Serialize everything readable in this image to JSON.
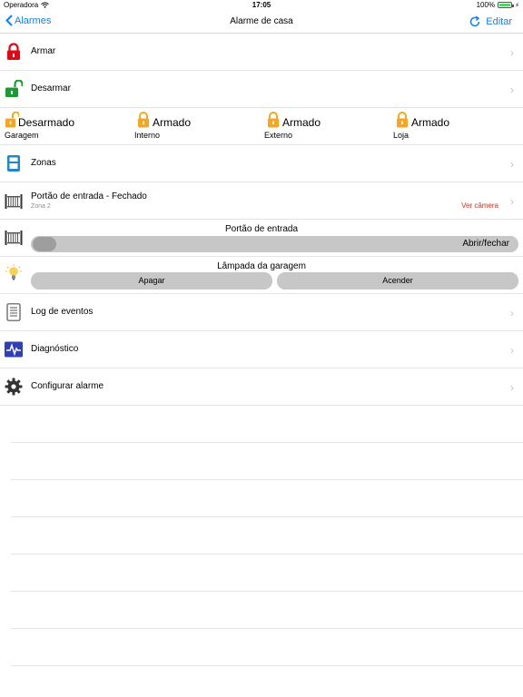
{
  "status_bar": {
    "carrier": "Operadora",
    "time": "17:05",
    "battery_percent": "100%",
    "battery_level": 1.0
  },
  "nav": {
    "back_label": "Alarmes",
    "title": "Alarme de casa",
    "edit_label": "Editar"
  },
  "rows": {
    "arm": "Armar",
    "disarm": "Desarmar",
    "zones": "Zonas",
    "events_log": "Log de eventos",
    "diagnostics": "Diagnóstico",
    "configure": "Configurar alarme"
  },
  "partitions": [
    {
      "state": "Desarmado",
      "name": "Garagem"
    },
    {
      "state": "Armado",
      "name": "Interno"
    },
    {
      "state": "Armado",
      "name": "Externo"
    },
    {
      "state": "Armado",
      "name": "Loja"
    }
  ],
  "gate_row": {
    "title": "Portão de entrada - Fechado",
    "subtitle": "Zona 2",
    "camera_link": "Ver câmera"
  },
  "gate_control": {
    "title": "Portão de entrada",
    "action_label": "Abrir/fechar"
  },
  "lamp_control": {
    "title": "Lâmpada da garagem",
    "off_label": "Apagar",
    "on_label": "Acender"
  },
  "colors": {
    "accent": "#147efb",
    "armed_icon": "#e30613",
    "disarmed_icon": "#1a9c33",
    "partition_lock": "#f5a623",
    "zones_icon": "#1e88c8",
    "diagnostic_icon": "#2f3fb4",
    "camera_link": "#c0392b"
  }
}
